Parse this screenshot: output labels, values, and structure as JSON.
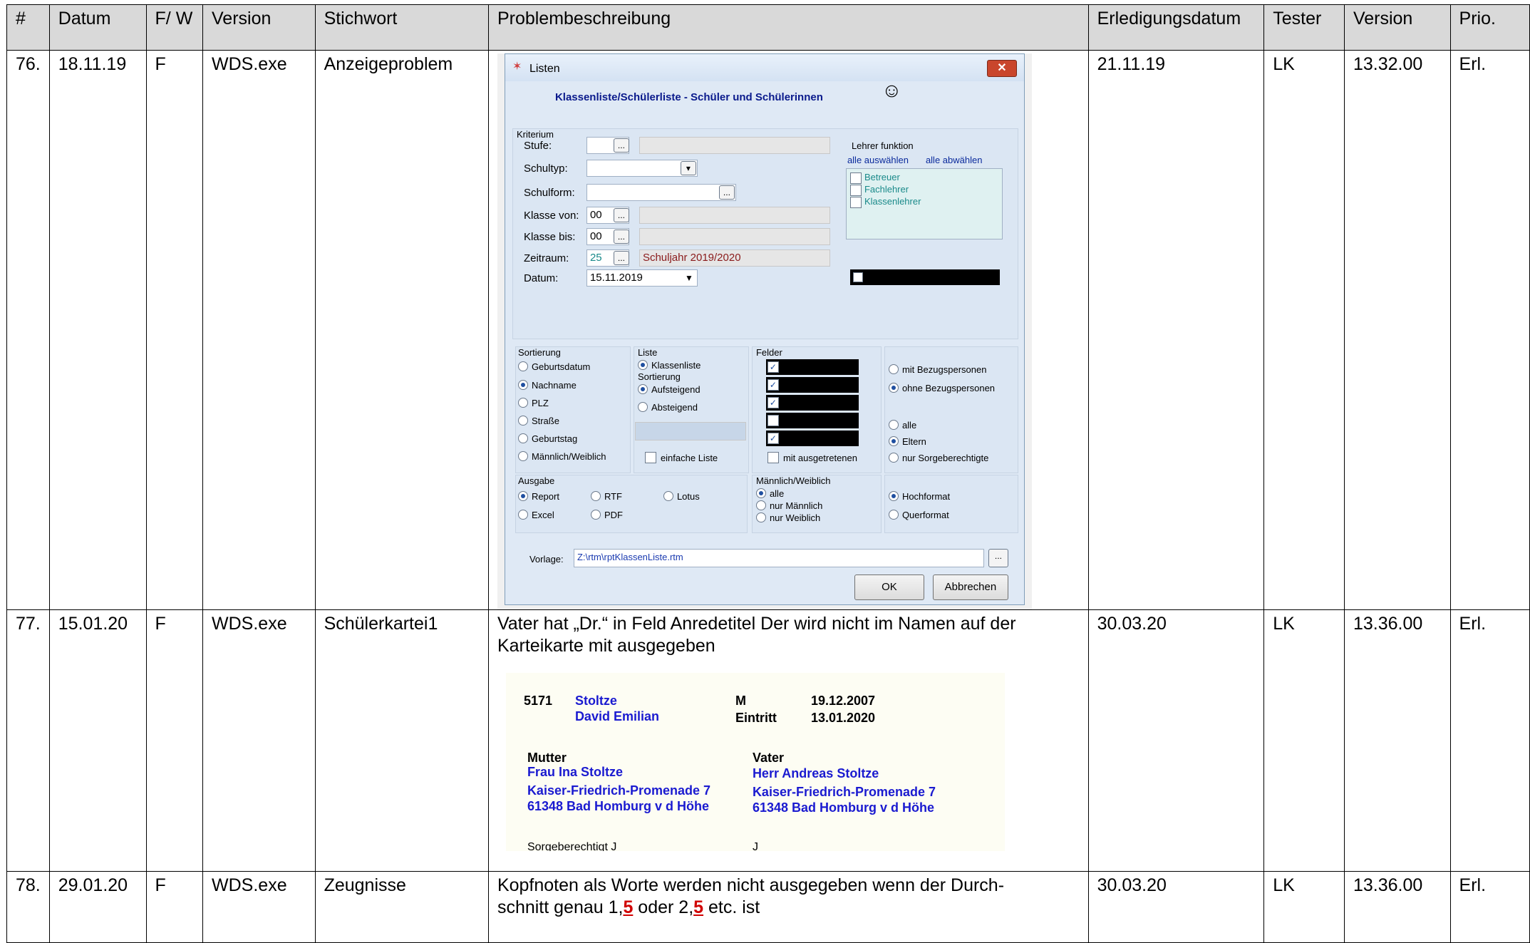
{
  "table": {
    "headers": [
      "#",
      "Datum",
      "F/ W",
      "Version",
      "Stichwort",
      "Problembeschreibung",
      "Erledigungsdatum",
      "Tester",
      "Version",
      "Prio."
    ],
    "rows": [
      {
        "nr": "76.",
        "datum": "18.11.19",
        "fw": "F",
        "version": "WDS.exe",
        "stichwort": "Anzeigeproblem",
        "beschreibung": "",
        "erledigt": "21.11.19",
        "tester": "LK",
        "version2": "13.32.00",
        "prio": "Erl."
      },
      {
        "nr": "77.",
        "datum": "15.01.20",
        "fw": "F",
        "version": "WDS.exe",
        "stichwort": "Schülerkartei1",
        "beschreibung": "Vater hat „Dr.“ in Feld Anredetitel Der wird nicht im Namen auf der Karteikarte mit ausgegeben",
        "erledigt": "30.03.20",
        "tester": "LK",
        "version2": "13.36.00",
        "prio": "Erl."
      },
      {
        "nr": "78.",
        "datum": "29.01.20",
        "fw": "F",
        "version": "WDS.exe",
        "stichwort": "Zeugnisse",
        "beschreibung_a": "Kopfnoten als Worte werden nicht ausgegeben wenn der Durch-",
        "beschreibung_b": "schnitt genau 1,",
        "beschreibung_c": "5",
        "beschreibung_d": " oder 2,",
        "beschreibung_e": "5",
        "beschreibung_f": " etc. ist",
        "erledigt": "30.03.20",
        "tester": "LK",
        "version2": "13.36.00",
        "prio": "Erl."
      }
    ]
  },
  "dialog": {
    "title": "Listen",
    "heading": "Klassenliste/Schülerliste - Schüler und Schülerinnen",
    "kriterium": "Kriterium",
    "stufe": "Stufe:",
    "schultyp": "Schultyp:",
    "schulform": "Schulform:",
    "klasse_von": "Klasse von:",
    "klasse_von_val": "00",
    "klasse_bis": "Klasse bis:",
    "klasse_bis_val": "00",
    "zeitraum": "Zeitraum:",
    "zeitraum_val": "25",
    "zeitraum_text": "Schuljahr 2019/2020",
    "datum": "Datum:",
    "datum_val": "15.11.2019",
    "lehrer_funktion": "Lehrer funktion",
    "alle_auswaehlen": "alle auswählen",
    "alle_abwaehlen": "alle abwählen",
    "lehrer_items": [
      "Betreuer",
      "Fachlehrer",
      "Klassenlehrer"
    ],
    "sortierung": "Sortierung",
    "sort_items": [
      "Geburtsdatum",
      "Nachname",
      "PLZ",
      "Straße",
      "Geburtstag",
      "Männlich/Weiblich"
    ],
    "liste": "Liste",
    "klassenliste": "Klassenliste",
    "sortierung2": "Sortierung",
    "aufsteigend": "Aufsteigend",
    "absteigend": "Absteigend",
    "einfache_liste": "einfache Liste",
    "felder": "Felder",
    "mit_ausgetretenen": "mit ausgetretenen",
    "mit_bezug": "mit Bezugspersonen",
    "ohne_bezug": "ohne Bezugspersonen",
    "alle": "alle",
    "eltern": "Eltern",
    "nur_sorge": "nur Sorgeberechtigte",
    "ausgabe": "Ausgabe",
    "report": "Report",
    "rtf": "RTF",
    "lotus": "Lotus",
    "excel": "Excel",
    "pdf": "PDF",
    "mw": "Männlich/Weiblich",
    "mw_alle": "alle",
    "nur_m": "nur Männlich",
    "nur_w": "nur Weiblich",
    "hochformat": "Hochformat",
    "querformat": "Querformat",
    "vorlage": "Vorlage:",
    "vorlage_val": "Z:\\rtm\\rptKlassenListe.rtm",
    "ok": "OK",
    "abbrechen": "Abbrechen",
    "dots": "..."
  },
  "card": {
    "nr": "5171",
    "name1": "Stoltze",
    "name2": "David Emilian",
    "m": "M",
    "geb": "19.12.2007",
    "eintritt": "Eintritt",
    "eintritt_date": "13.01.2020",
    "mutter": "Mutter",
    "mutter_name": "Frau Ina Stoltze",
    "mutter_str": "Kaiser-Friedrich-Promenade 7",
    "mutter_ort": "61348  Bad Homburg v d Höhe",
    "vater": "Vater",
    "vater_name": "Herr Andreas Stoltze",
    "vater_str": "Kaiser-Friedrich-Promenade 7",
    "vater_ort": "61348  Bad Homburg v d Höhe",
    "sorge": "Sorgeberechtigt  J",
    "sorge2": "J"
  }
}
